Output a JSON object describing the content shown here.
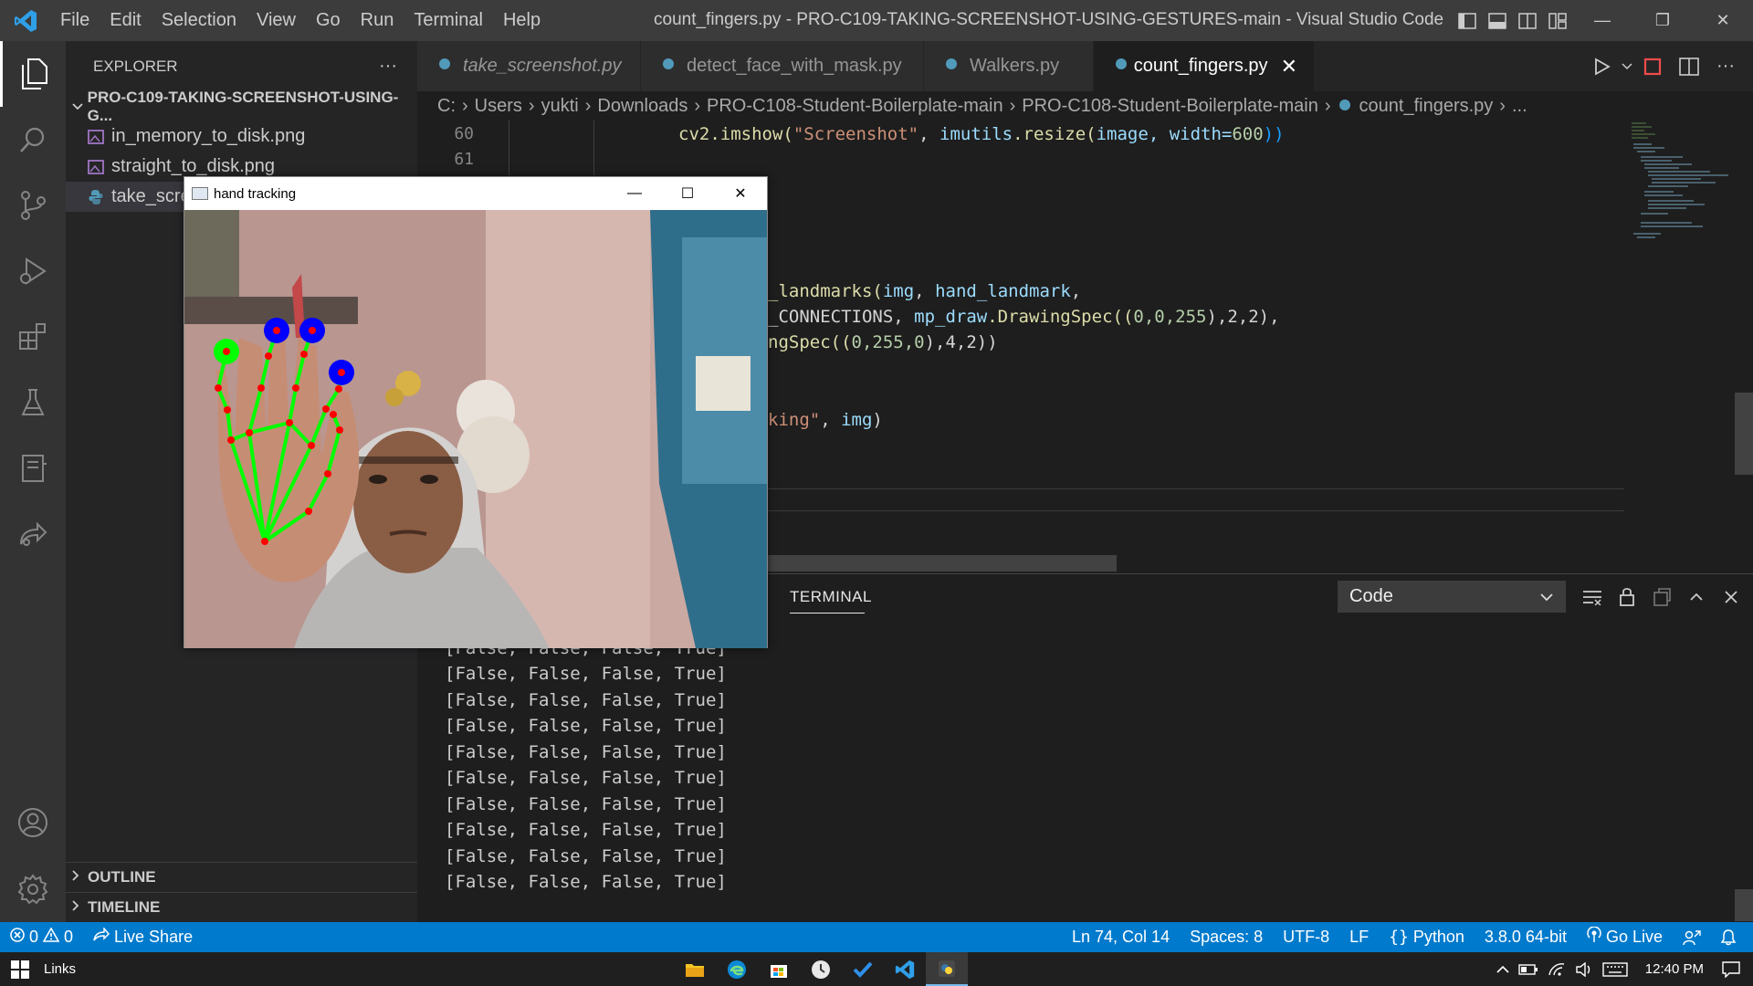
{
  "titlebar": {
    "menu": [
      "File",
      "Edit",
      "Selection",
      "View",
      "Go",
      "Run",
      "Terminal",
      "Help"
    ],
    "title": "count_fingers.py - PRO-C109-TAKING-SCREENSHOT-USING-GESTURES-main - Visual Studio Code",
    "controls": {
      "minimize": "—",
      "restore": "❐",
      "close": "✕"
    }
  },
  "activitybar": [
    "explorer-icon",
    "search-icon",
    "source-control-icon",
    "run-debug-icon",
    "extensions-icon",
    "testing-icon",
    "notebook-icon",
    "live-share-icon",
    "account-icon",
    "settings-gear-icon"
  ],
  "sidebar": {
    "header": "EXPLORER",
    "more": "···",
    "folder": "PRO-C109-TAKING-SCREENSHOT-USING-G...",
    "files": [
      {
        "name": "in_memory_to_disk.png",
        "type": "image"
      },
      {
        "name": "straight_to_disk.png",
        "type": "image"
      },
      {
        "name": "take_scre",
        "type": "python"
      }
    ],
    "outline": "OUTLINE",
    "timeline": "TIMELINE"
  },
  "tabs": [
    {
      "label": "take_screenshot.py",
      "italic": true
    },
    {
      "label": "detect_face_with_mask.py",
      "italic": false
    },
    {
      "label": "Walkers.py",
      "italic": false
    },
    {
      "label": "count_fingers.py",
      "italic": false,
      "active": true
    }
  ],
  "tab_close": "✕",
  "breadcrumb": [
    "C:",
    "Users",
    "yukti",
    "Downloads",
    "PRO-C108-Student-Boilerplate-main",
    "PRO-C108-Student-Boilerplate-main",
    "count_fingers.py",
    "..."
  ],
  "editor": {
    "line_numbers": [
      "60",
      "61"
    ],
    "line60": {
      "fn": "cv2.imshow(",
      "s": "\"Screenshot\"",
      "c": ", ",
      "v": "imutils",
      "r": ".resize(",
      "v2": "image",
      "k": ", width=",
      "n": "600",
      "e": "))"
    },
    "frag1": {
      "a": "_landmarks(",
      "b": "img",
      "c": ", ",
      "d": "hand_landmark",
      "e": ","
    },
    "frag2": {
      "a": "_CONNECTIONS, ",
      "b": "mp_draw",
      "c": ".DrawingSpec((",
      "d": "0,0,255",
      "e": "),2,2),"
    },
    "frag3": {
      "a": "ngSpec((",
      "b": "0,255,0",
      "c": "),4,2))"
    },
    "frag4": {
      "a": "king\"",
      "b": ", ",
      "c": "img",
      "d": ")"
    }
  },
  "panel": {
    "tab": "TERMINAL",
    "select_value": "Code",
    "lines": [
      "[False, False, False, True]",
      "[False, False, False, True]",
      "[False, False, False, True]",
      "[False, False, False, True]",
      "[False, False, False, True]",
      "[False, False, False, True]",
      "[False, False, False, True]",
      "[False, False, False, True]",
      "[False, False, False, True]",
      "[False, False, False, True]"
    ]
  },
  "statusbar": {
    "errors": "0",
    "warnings": "0",
    "liveshare": "Live Share",
    "position": "Ln 74, Col 14",
    "spaces": "Spaces: 8",
    "encoding": "UTF-8",
    "eol": "LF",
    "language": "Python",
    "interpreter": "3.8.0 64-bit",
    "golive": "Go Live"
  },
  "cvwindow": {
    "title": "hand tracking",
    "controls": {
      "minimize": "—",
      "maximize": "☐",
      "close": "✕"
    }
  },
  "taskbar": {
    "links": "Links",
    "time": "12:40 PM"
  },
  "colors": {
    "accent": "#007acc",
    "titlebar": "#3c3c3c",
    "editor_bg": "#1e1e1e",
    "sidebar_bg": "#252526",
    "landmark_line": "#00ff00",
    "landmark_point": "#ff0000",
    "fingertip_blue": "#0000ff"
  }
}
